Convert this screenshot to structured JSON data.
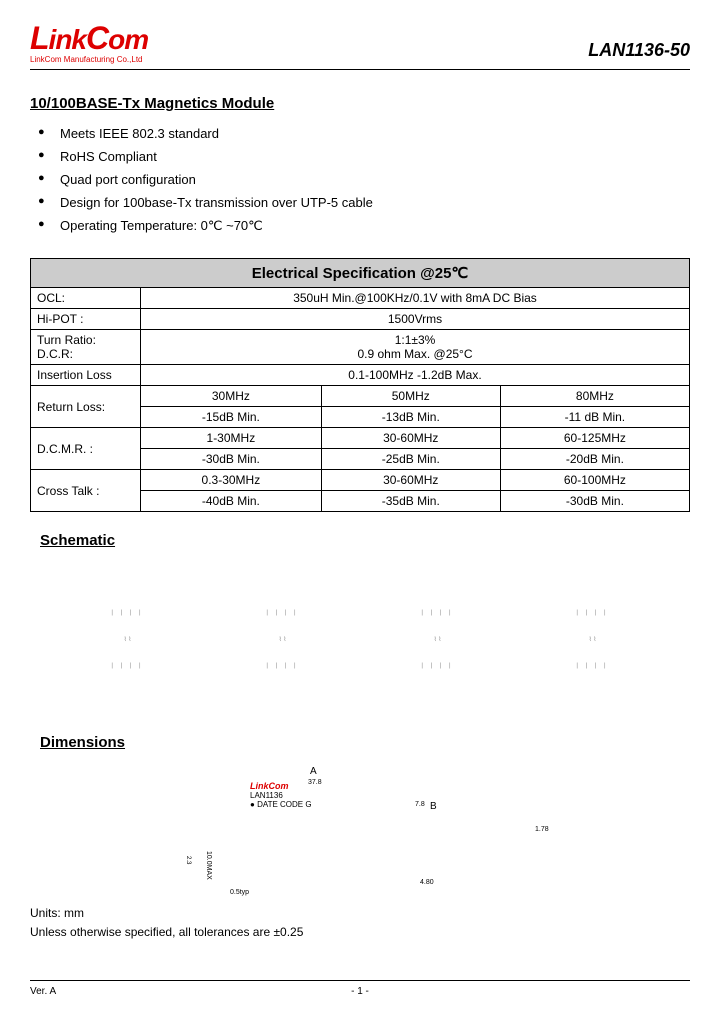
{
  "logo": {
    "text": "LinkCom",
    "subtitle": "LinkCom Manufacturing Co.,Ltd"
  },
  "part_number": "LAN1136-50",
  "title": "10/100BASE-Tx Magnetics Module",
  "bullets": [
    "Meets IEEE 802.3 standard",
    "RoHS Compliant",
    "Quad port configuration",
    "Design for 100base-Tx transmission over UTP-5 cable",
    "Operating Temperature: 0℃ ~70℃"
  ],
  "spec": {
    "header": "Electrical Specification @25℃",
    "rows": {
      "ocl_label": "OCL:",
      "ocl_val": "350uH Min.@100KHz/0.1V with 8mA DC Bias",
      "hipot_label": "Hi-POT :",
      "hipot_val": "1500Vrms",
      "turn_label": "Turn Ratio:",
      "turn_val": "1:1±3%",
      "dcr_label": "D.C.R:",
      "dcr_val": "0.9 ohm Max. @25°C",
      "ins_label": "Insertion Loss",
      "ins_val": "0.1-100MHz   -1.2dB Max.",
      "ret_label": "Return Loss:",
      "ret_f1": "30MHz",
      "ret_f2": "50MHz",
      "ret_f3": "80MHz",
      "ret_v1": "-15dB Min.",
      "ret_v2": "-13dB Min.",
      "ret_v3": "-11 dB Min.",
      "dcmr_label": "D.C.M.R. :",
      "dcmr_f1": "1-30MHz",
      "dcmr_f2": "30-60MHz",
      "dcmr_f3": "60-125MHz",
      "dcmr_v1": "-30dB Min.",
      "dcmr_v2": "-25dB Min.",
      "dcmr_v3": "-20dB Min.",
      "ct_label": "Cross Talk :",
      "ct_f1": "0.3-30MHz",
      "ct_f2": "30-60MHz",
      "ct_f3": "60-100MHz",
      "ct_v1": "-40dB Min.",
      "ct_v2": "-35dB Min.",
      "ct_v3": "-30dB Min."
    }
  },
  "sections": {
    "schematic": "Schematic",
    "dimensions": "Dimensions"
  },
  "dims": {
    "a_label": "A",
    "a_val": "37.8",
    "logo": "LinkCom",
    "part": "LAN1136",
    "datecode": "DATE CODE G",
    "b_val": "7.8",
    "b_label": "B",
    "c_val": "1.78",
    "pins": "10.0MAX",
    "side": "2.3",
    "typ": "0.5typ",
    "pitch": "4.80"
  },
  "units_line1": "Units: mm",
  "units_line2": "Unless otherwise specified, all tolerances are ±0.25",
  "footer": {
    "ver": "Ver. A",
    "page": "- 1 -"
  }
}
